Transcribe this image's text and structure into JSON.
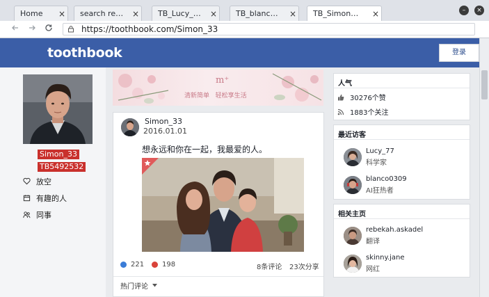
{
  "browser": {
    "tabs": [
      {
        "label": "Home",
        "active": false
      },
      {
        "label": "search re…",
        "active": false
      },
      {
        "label": "TB_Lucy_…",
        "active": false
      },
      {
        "label": "TB_blanc…",
        "active": false
      },
      {
        "label": "TB_Simon…",
        "active": true
      }
    ],
    "tab_close_glyph": "×",
    "window_minimize_glyph": "–",
    "window_close_glyph": "×",
    "url": "https://toothbook.com/Simon_33"
  },
  "site": {
    "logo": "toothbook",
    "login_label": "登录",
    "brand_color": "#3b5ea7"
  },
  "profile": {
    "name": "Simon_33",
    "id": "TB5492532",
    "badge_color": "#c9302c",
    "menu": [
      {
        "icon": "heart-icon",
        "label": "放空"
      },
      {
        "icon": "calendar-icon",
        "label": "有趣的人"
      },
      {
        "icon": "people-icon",
        "label": "同事"
      }
    ]
  },
  "banner": {
    "logo_text": "m⁺",
    "caption": "清新简单   轻松享生活"
  },
  "post": {
    "author": "Simon_33",
    "date": "2016.01.01",
    "text": "想永远和你在一起，我最爱的人。",
    "likes": "221",
    "dislikes": "198",
    "comments": "8条评论",
    "shares": "23次分享",
    "hot_comments": "热门评论",
    "like_color": "#3b7dd8",
    "dislike_color": "#d9433a"
  },
  "popularity": {
    "title": "人气",
    "likes_line": "30276个赞",
    "followers_line": "1883个关注"
  },
  "recent_visitors": {
    "title": "最近访客",
    "people": [
      {
        "name": "Lucy_77",
        "role": "科学家"
      },
      {
        "name": "blanco0309",
        "role": "AI狂热者"
      }
    ]
  },
  "related_pages": {
    "title": "相关主页",
    "people": [
      {
        "name": "rebekah.askadel",
        "role": "翻译"
      },
      {
        "name": "skinny.jane",
        "role": "网红"
      }
    ]
  }
}
